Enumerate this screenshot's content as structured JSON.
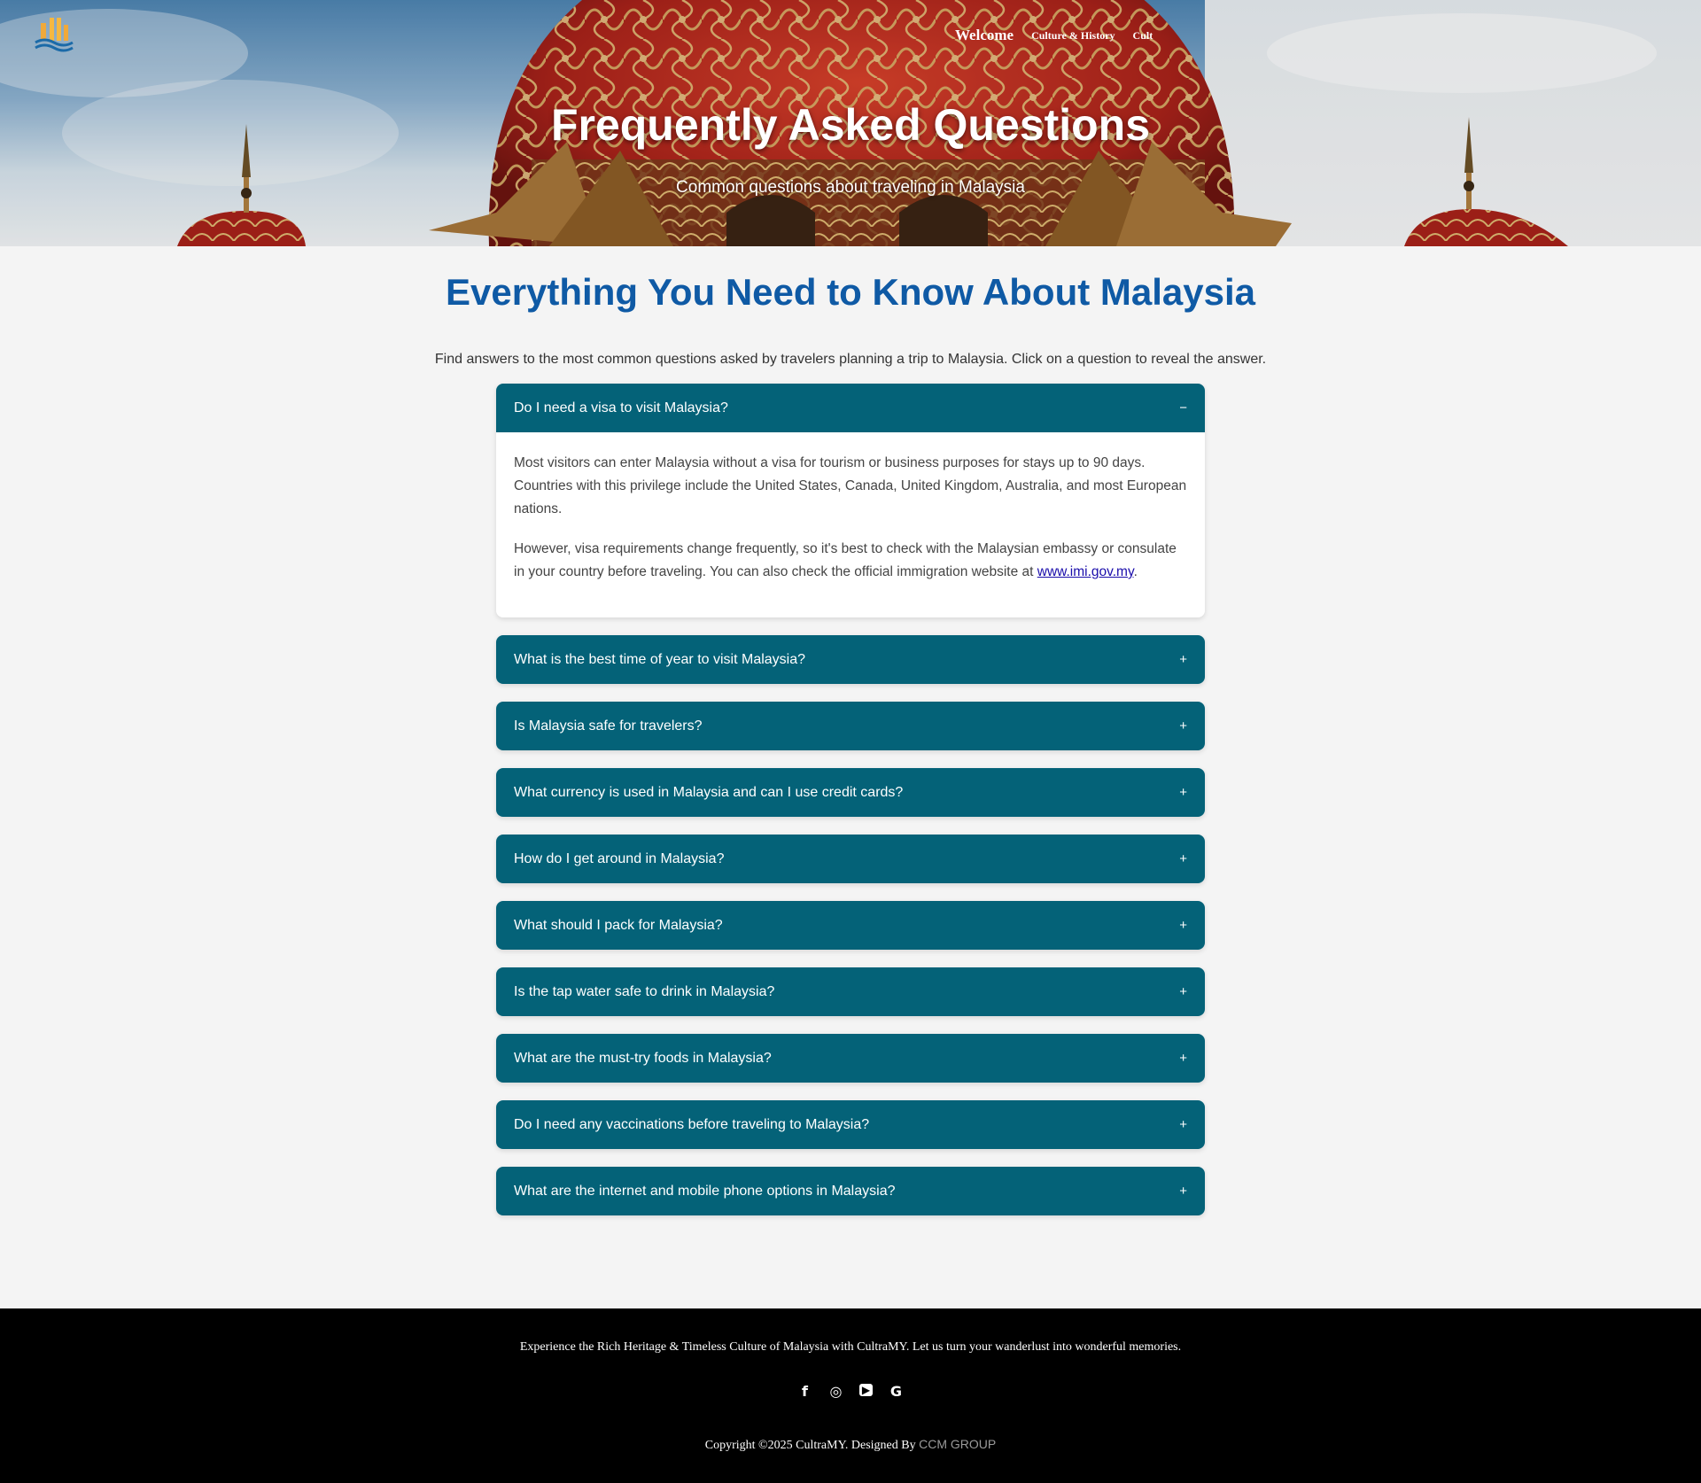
{
  "nav": {
    "items": [
      {
        "label": "Welcome",
        "active": true
      },
      {
        "label": "Culture & History",
        "active": false
      },
      {
        "label": "Cult",
        "active": false
      }
    ]
  },
  "hero": {
    "title": "Frequently Asked Questions",
    "subtitle": "Common questions about traveling in Malaysia"
  },
  "main": {
    "title": "Everything You Need to Know About Malaysia",
    "intro": "Find answers to the most common questions asked by travelers planning a trip to Malaysia. Click on a question to reveal the answer."
  },
  "faq": {
    "open_sign": "−",
    "closed_sign": "+",
    "items": [
      {
        "question": "Do I need a visa to visit Malaysia?",
        "expanded": true,
        "answer_p1": "Most visitors can enter Malaysia without a visa for tourism or business purposes for stays up to 90 days. Countries with this privilege include the United States, Canada, United Kingdom, Australia, and most European nations.",
        "answer_p2": "However, visa requirements change frequently, so it's best to check with the Malaysian embassy or consulate in your country before traveling. You can also check the official immigration website at",
        "answer_link": "www.imi.gov.my",
        "answer_end": "."
      },
      {
        "question": "What is the best time of year to visit Malaysia?",
        "expanded": false
      },
      {
        "question": "Is Malaysia safe for travelers?",
        "expanded": false
      },
      {
        "question": "What currency is used in Malaysia and can I use credit cards?",
        "expanded": false
      },
      {
        "question": "How do I get around in Malaysia?",
        "expanded": false
      },
      {
        "question": "What should I pack for Malaysia?",
        "expanded": false
      },
      {
        "question": "Is the tap water safe to drink in Malaysia?",
        "expanded": false
      },
      {
        "question": "What are the must-try foods in Malaysia?",
        "expanded": false
      },
      {
        "question": "Do I need any vaccinations before traveling to Malaysia?",
        "expanded": false
      },
      {
        "question": "What are the internet and mobile phone options in Malaysia?",
        "expanded": false
      }
    ]
  },
  "footer": {
    "tagline": "Experience the Rich Heritage & Timeless Culture of Malaysia with CultraMY. Let us turn your wanderlust into wonderful memories.",
    "copyright": "Copyright ©2025 CultraMY. Designed By",
    "designer": "CCM GROUP",
    "social": [
      {
        "icon": "facebook-icon",
        "glyph": "f"
      },
      {
        "icon": "instagram-icon",
        "glyph": "◎"
      },
      {
        "icon": "youtube-icon",
        "glyph": "▶"
      },
      {
        "icon": "google-icon",
        "glyph": "G"
      }
    ]
  },
  "colors": {
    "accent_heading": "#0f5aa5",
    "faq_header": "#046278",
    "footer_bg": "#000000",
    "page_bg": "#f4f4f4"
  }
}
